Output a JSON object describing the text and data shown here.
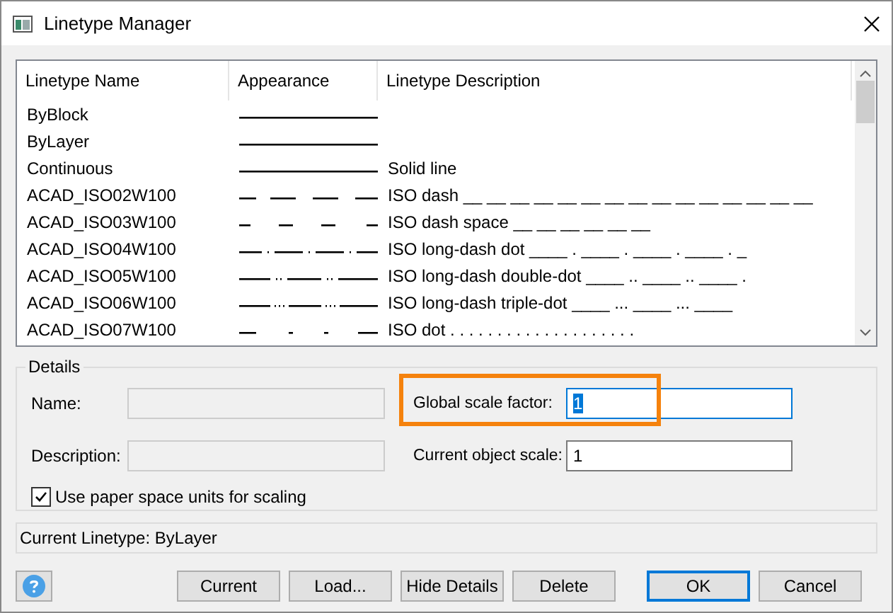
{
  "window": {
    "title": "Linetype Manager"
  },
  "table": {
    "columns": [
      "Linetype Name",
      "Appearance",
      "Linetype Description"
    ],
    "rows": [
      {
        "name": "ByBlock",
        "kind": "solid"
      },
      {
        "name": "ByLayer",
        "kind": "solid"
      },
      {
        "name": "Continuous",
        "kind": "solid",
        "description": "Solid line"
      },
      {
        "name": "ACAD_ISO02W100",
        "kind": "dash",
        "description": "ISO dash __ __ __ __ __ __ __ __ __ __ __ __ __ __ __"
      },
      {
        "name": "ACAD_ISO03W100",
        "kind": "dash-space",
        "description": "ISO dash space __    __    __    __    __    __"
      },
      {
        "name": "ACAD_ISO04W100",
        "kind": "long-dash-dot",
        "description": "ISO long-dash dot ____ . ____ . ____ . ____ . _"
      },
      {
        "name": "ACAD_ISO05W100",
        "kind": "long-dash-double-dot",
        "description": "ISO long-dash double-dot ____ .. ____ .. ____ ."
      },
      {
        "name": "ACAD_ISO06W100",
        "kind": "long-dash-triple-dot",
        "description": "ISO long-dash triple-dot ____ ... ____ ... ____"
      },
      {
        "name": "ACAD_ISO07W100",
        "kind": "dot",
        "description": "ISO dot . . . . . . . . . . . . . . . . . . . ."
      }
    ]
  },
  "details": {
    "title": "Details",
    "name_label": "Name:",
    "description_label": "Description:",
    "global_scale": {
      "label": "Global scale factor:",
      "value": "1",
      "text_selected": true,
      "highlighted": true
    },
    "object_scale": {
      "label": "Current object scale:",
      "value": "1"
    },
    "paper_space": {
      "label": "Use paper space units for scaling",
      "checked": true
    }
  },
  "status": "Current Linetype: ByLayer",
  "buttons": [
    {
      "label": "Current",
      "default": false
    },
    {
      "label": "Load...",
      "default": false
    },
    {
      "label": "Hide Details",
      "default": false
    },
    {
      "label": "Delete",
      "default": false
    },
    {
      "label": "OK",
      "default": true
    },
    {
      "label": "Cancel",
      "default": false
    }
  ]
}
